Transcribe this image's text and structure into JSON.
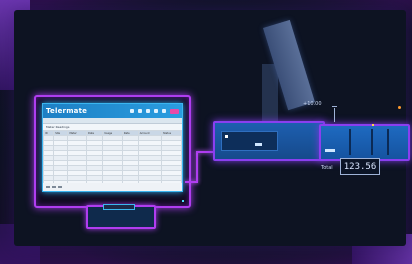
{
  "app": {
    "logo": "Telermate",
    "table_title": "Meter Readings",
    "columns": [
      "ID",
      "Site",
      "Meter",
      "Date",
      "Usage",
      "Rate",
      "Amount",
      "Status"
    ],
    "rows": [
      [
        "",
        "",
        "",
        "",
        "",
        "",
        "",
        ""
      ],
      [
        "",
        "",
        "",
        "",
        "",
        "",
        "",
        ""
      ],
      [
        "",
        "",
        "",
        "",
        "",
        "",
        "",
        ""
      ],
      [
        "",
        "",
        "",
        "",
        "",
        "",
        "",
        ""
      ],
      [
        "",
        "",
        "",
        "",
        "",
        "",
        "",
        ""
      ],
      [
        "",
        "",
        "",
        "",
        "",
        "",
        "",
        ""
      ],
      [
        "",
        "",
        "",
        "",
        "",
        "",
        "",
        ""
      ],
      [
        "",
        "",
        "",
        "",
        "",
        "",
        "",
        ""
      ],
      [
        "",
        "",
        "",
        "",
        "",
        "",
        "",
        ""
      ],
      [
        "",
        "",
        "",
        "",
        "",
        "",
        "",
        ""
      ]
    ]
  },
  "readout": {
    "top_label": "+10.00",
    "total_label": "Total",
    "total_value": "123.56"
  },
  "colors": {
    "neon_purple": "#b03df0",
    "neon_blue": "#3bb6f0",
    "app_header": "#1d7fc4",
    "accent_pink": "#e84aa8"
  }
}
